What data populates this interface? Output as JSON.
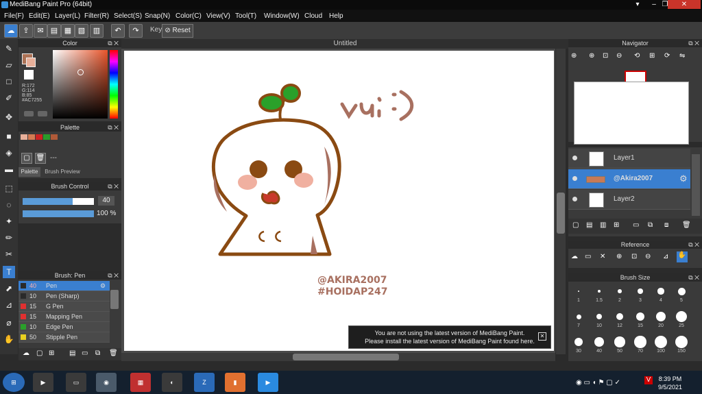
{
  "window": {
    "title": "MediBang Paint Pro (64bit)"
  },
  "menu": [
    "File(F)",
    "Edit(E)",
    "Layer(L)",
    "Filter(R)",
    "Select(S)",
    "Snap(N)",
    "Color(C)",
    "View(V)",
    "Tool(T)",
    "Window(W)",
    "Cloud",
    "Help"
  ],
  "toolbar": {
    "key_label": "Key",
    "reset_label": "Reset"
  },
  "color_panel": {
    "title": "Color",
    "r": "R:172",
    "g": "G:114",
    "b": "B:85",
    "hex": "#AC7255",
    "main_color": "#AC7255"
  },
  "palette_panel": {
    "title": "Palette",
    "placeholder": "---",
    "tab_palette": "Palette",
    "tab_brush_preview": "Brush Preview",
    "swatches": [
      "#e8b09a",
      "#d47a52",
      "#cc2222",
      "#2a9a2a",
      "#b05a38"
    ]
  },
  "brush_control": {
    "title": "Brush Control",
    "size": "40",
    "opacity": "100 %",
    "size_fraction": 0.7,
    "opacity_fraction": 1.0
  },
  "brush_list": {
    "title": "Brush: Pen",
    "items": [
      {
        "size": "40",
        "name": "Pen",
        "color": "#2a2a2a"
      },
      {
        "size": "10",
        "name": "Pen (Sharp)",
        "color": "#2a2a2a"
      },
      {
        "size": "15",
        "name": "G Pen",
        "color": "#e03030"
      },
      {
        "size": "15",
        "name": "Mapping Pen",
        "color": "#e03030"
      },
      {
        "size": "10",
        "name": "Edge Pen",
        "color": "#2aa02a"
      },
      {
        "size": "50",
        "name": "Stipple Pen",
        "color": "#e8d020"
      }
    ]
  },
  "document": {
    "tab": "Untitled"
  },
  "canvas_text": {
    "vui": "vui :)",
    "tag1": "@AKIRA2007",
    "tag2": "#HOIDAP247"
  },
  "notice": {
    "line1": "You are not using the latest version of MediBang Paint.",
    "line2": "Please install the latest version of MediBang Paint found here."
  },
  "navigator": {
    "title": "Navigator"
  },
  "layers": {
    "items": [
      {
        "name": "Layer1"
      },
      {
        "name": "@Akira2007"
      },
      {
        "name": "Layer2"
      }
    ]
  },
  "reference": {
    "title": "Reference"
  },
  "brush_size": {
    "title": "Brush Size",
    "sizes": [
      "1",
      "1.5",
      "2",
      "3",
      "4",
      "5",
      "7",
      "10",
      "12",
      "15",
      "20",
      "25",
      "30",
      "40",
      "50",
      "70",
      "100",
      "150"
    ]
  },
  "taskbar": {
    "time": "8:39 PM",
    "date": "9/5/2021"
  }
}
